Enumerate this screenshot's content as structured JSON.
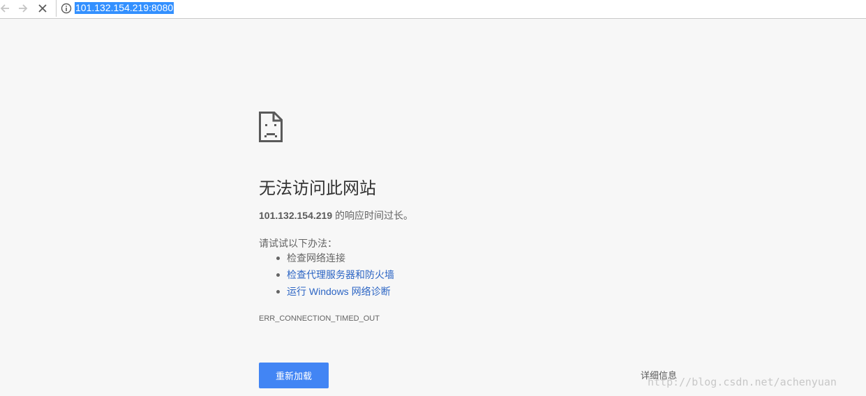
{
  "browser": {
    "address": "101.132.154.219:8080",
    "icons": {
      "back": "arrow-left-icon",
      "forward": "arrow-right-icon",
      "stop": "close-icon",
      "site_info": "info-icon"
    }
  },
  "error_page": {
    "icon": "sad-page-icon",
    "heading": "无法访问此网站",
    "summary_host": "101.132.154.219",
    "summary_text": " 的响应时间过长。",
    "suggestions_title": "请试试以下办法：",
    "suggestions": [
      {
        "label": "检查网络连接",
        "link": false
      },
      {
        "label": "检查代理服务器和防火墙",
        "link": true
      },
      {
        "label": "运行 Windows 网络诊断",
        "link": true
      }
    ],
    "error_code": "ERR_CONNECTION_TIMED_OUT",
    "reload_label": "重新加载",
    "details_label": "详细信息"
  },
  "watermark": "http://blog.csdn.net/achenyuan",
  "colors": {
    "accent": "#4285f4",
    "link": "#2c65c4",
    "selection": "#3390ff",
    "background": "#f7f7f7"
  }
}
